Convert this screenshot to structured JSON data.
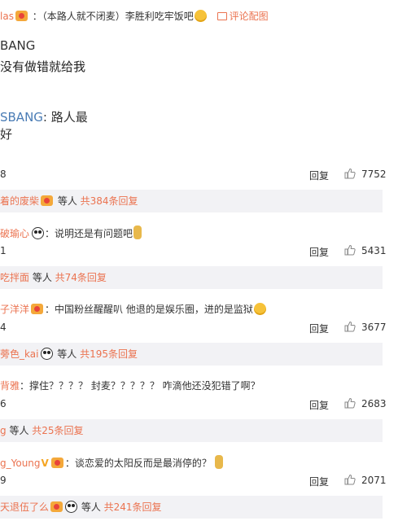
{
  "top_comment": {
    "user": "las",
    "text": "：（本路人就不闭麦）李胜利吃牢饭吧",
    "pic_link": "评论配图",
    "image": {
      "line1": "BANG",
      "line2": "没有做错就给我",
      "line3_name": "SBANG",
      "line3_text": ": 路人最好"
    },
    "time": "8",
    "reply": "回复",
    "likes": "7752",
    "reply_bar": {
      "user": "着的废柴",
      "middle": " 等人 ",
      "count": "共384条回复"
    }
  },
  "comments": [
    {
      "user": "破瑜心",
      "text": "：说明还是有问题吧",
      "time": "1",
      "reply": "回复",
      "likes": "5431",
      "reply_bar": {
        "user": "吃拌面",
        "middle": " 等人 ",
        "count": "共74条回复"
      }
    },
    {
      "user": "子洋洋",
      "text": "：中国粉丝醒醒叭  他退的是娱乐圈，进的是监狱",
      "time": "4",
      "reply": "回复",
      "likes": "3677",
      "reply_bar": {
        "user": "蒡色_kai",
        "middle": " 等人 ",
        "count": "共195条回复"
      }
    },
    {
      "user": "背雅",
      "text": "：撑住？？？？ 封麦？？？？？ 咋滴他还没犯错了啊？",
      "time": "6",
      "reply": "回复",
      "likes": "2683",
      "reply_bar": {
        "user": "g",
        "middle": " 等人 ",
        "count": "共25条回复"
      }
    },
    {
      "user": "g_Young",
      "text": "：谈恋爱的太阳反而是最消停的？",
      "time": "9",
      "reply": "回复",
      "likes": "2071",
      "reply_bar": {
        "user": "天退伍了么",
        "middle": " 等人 ",
        "count": "共241条回复"
      }
    }
  ],
  "icons": {
    "like": "thumbs-up-icon",
    "picture": "picture-icon",
    "badge": "member-badge-icon",
    "verified": "verified-v-icon"
  },
  "colors": {
    "link": "#eb7350",
    "reply_bg": "#f2f2f5",
    "text": "#333333"
  },
  "verified_mark": "V"
}
